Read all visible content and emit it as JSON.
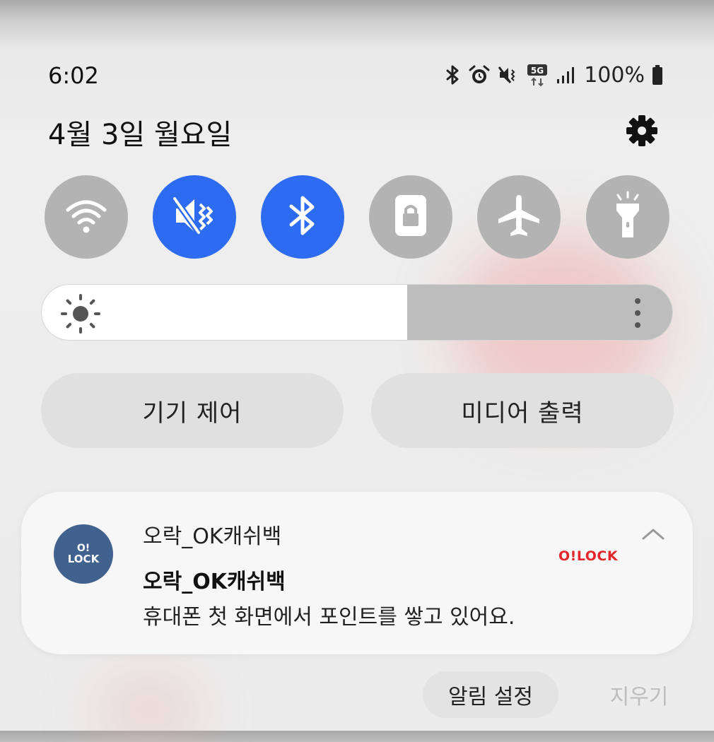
{
  "status_bar": {
    "time": "6:02",
    "icons": [
      "bluetooth-icon",
      "alarm-icon",
      "vibrate-mute-icon",
      "5g-icon",
      "signal-icon"
    ],
    "network_badge": "5G",
    "battery_percent": "100%"
  },
  "header": {
    "date": "4월 3일 월요일",
    "settings_icon": "gear-icon"
  },
  "quick_settings": [
    {
      "icon": "wifi-icon",
      "active": false
    },
    {
      "icon": "mute-vibrate-icon",
      "active": true
    },
    {
      "icon": "bluetooth-icon",
      "active": true
    },
    {
      "icon": "rotation-lock-icon",
      "active": false
    },
    {
      "icon": "airplane-icon",
      "active": false
    },
    {
      "icon": "flashlight-icon",
      "active": false
    }
  ],
  "brightness": {
    "level": 0.58,
    "icon": "sun-icon",
    "more_icon": "more-vertical-icon"
  },
  "buttons": {
    "device_control": "기기 제어",
    "media_output": "미디어 출력"
  },
  "notification": {
    "app_icon_line1": "O!",
    "app_icon_line2": "LOCK",
    "app_name": "오락_OK캐쉬백",
    "title": "오락_OK캐쉬백",
    "body": "휴대폰 첫 화면에서 포인트를 쌓고 있어요.",
    "brand_logo": "O!LOCK",
    "collapse_icon": "chevron-up-icon"
  },
  "actions": {
    "notification_settings": "알림 설정",
    "clear": "지우기"
  },
  "colors": {
    "active_blue": "#2d6cf0",
    "inactive_gray": "#b3b3b3",
    "brand_red": "#e3262c",
    "app_icon_blue": "#41618e"
  }
}
